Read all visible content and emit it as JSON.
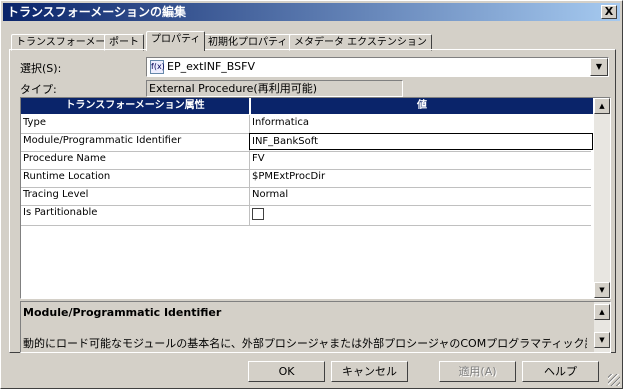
{
  "window": {
    "title": "トランスフォーメーションの編集",
    "close_label": "X"
  },
  "tabs": [
    {
      "label": "トランスフォーメーション"
    },
    {
      "label": "ポート"
    },
    {
      "label": "プロパティ"
    },
    {
      "label": "初期化プロパティ"
    },
    {
      "label": "メタデータ エクステンション"
    }
  ],
  "selection": {
    "label": "選択(S):",
    "icon_text": "f(x)",
    "value": "EP_extINF_BSFV"
  },
  "type": {
    "label": "タイプ:",
    "value": "External Procedure(再利用可能)"
  },
  "grid": {
    "headers": [
      "トランスフォーメーション属性",
      "値"
    ],
    "rows": [
      {
        "attr": "Type",
        "value": "Informatica"
      },
      {
        "attr": "Module/Programmatic Identifier",
        "value": "INF_BankSoft"
      },
      {
        "attr": "Procedure Name",
        "value": "FV"
      },
      {
        "attr": "Runtime Location",
        "value": "$PMExtProcDir"
      },
      {
        "attr": "Tracing Level",
        "value": "Normal"
      },
      {
        "attr": "Is Partitionable",
        "value": ""
      }
    ]
  },
  "description": {
    "title": "Module/Programmatic Identifier",
    "text": "動的にロード可能なモジュールの基本名に、外部プロシージャまたは外部プロシージャのCOMプログラマティック識別子が含まれています。"
  },
  "buttons": {
    "ok": "OK",
    "cancel": "キャンセル",
    "apply": "適用(A)",
    "help": "ヘルプ"
  }
}
